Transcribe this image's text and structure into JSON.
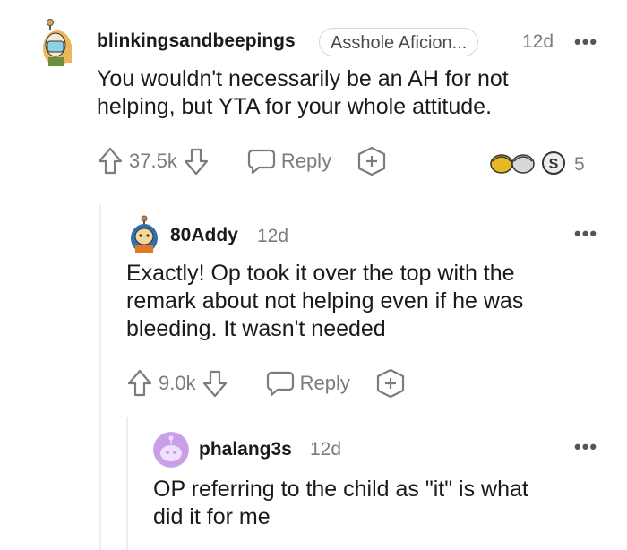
{
  "comments": [
    {
      "username": "blinkingsandbeepings",
      "flair": "Asshole Aficion...",
      "time": "12d",
      "body_lines": [
        "You wouldn't necessarily be an AH for not",
        "helping, but YTA for your whole attitude."
      ],
      "score": "37.5k",
      "reply_label": "Reply",
      "awards_count": "5"
    },
    {
      "username": "80Addy",
      "time": "12d",
      "body_lines": [
        "Exactly! Op took it over the top with the",
        "remark about not helping even if he was",
        "bleeding. It wasn't needed"
      ],
      "score": "9.0k",
      "reply_label": "Reply"
    },
    {
      "username": "phalang3s",
      "time": "12d",
      "body_lines": [
        "OP referring to the child as \"it\" is what",
        "did it for me"
      ]
    }
  ],
  "more_label": "•••",
  "colors": {
    "text": "#1a1a1b",
    "meta": "#7c7c7c",
    "thread": "#ededed",
    "award_gold": "#e8b923"
  },
  "icons": [
    "upvote-icon",
    "downvote-icon",
    "reply-icon",
    "award-icon",
    "more-options-icon"
  ]
}
